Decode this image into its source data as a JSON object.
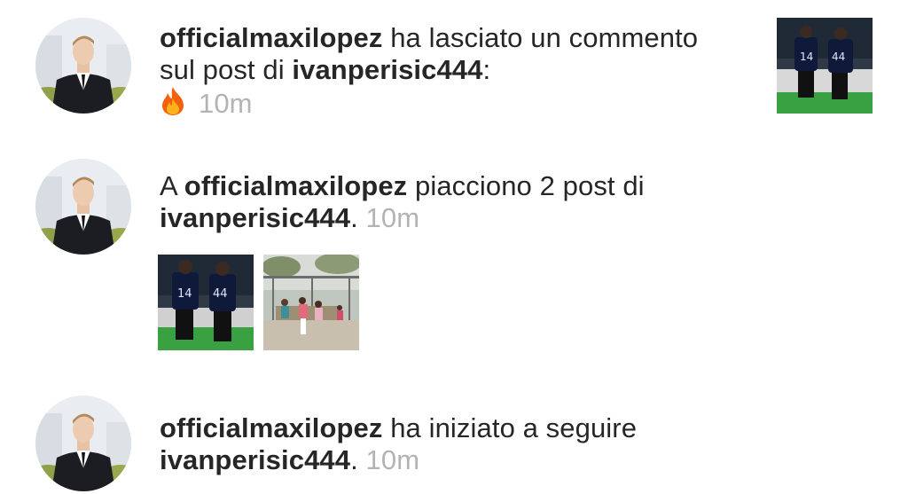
{
  "notifications": [
    {
      "username": "officialmaxilopez",
      "text_before": " ha lasciato un commento sul post di ",
      "target": "ivanperisic444",
      "text_after": ":",
      "comment_emoji": "fire-icon",
      "time": "10m"
    },
    {
      "prefix": "A ",
      "username": "officialmaxilopez",
      "text_before": " piacciono 2 post di ",
      "target": "ivanperisic444",
      "text_after": ".",
      "time": "10m"
    },
    {
      "username": "officialmaxilopez",
      "text_before": " ha iniziato a seguire ",
      "target": "ivanperisic444",
      "text_after": ".",
      "time": "10m"
    }
  ],
  "colors": {
    "text": "#262626",
    "timestamp": "#b3b3b3",
    "background": "#ffffff"
  }
}
